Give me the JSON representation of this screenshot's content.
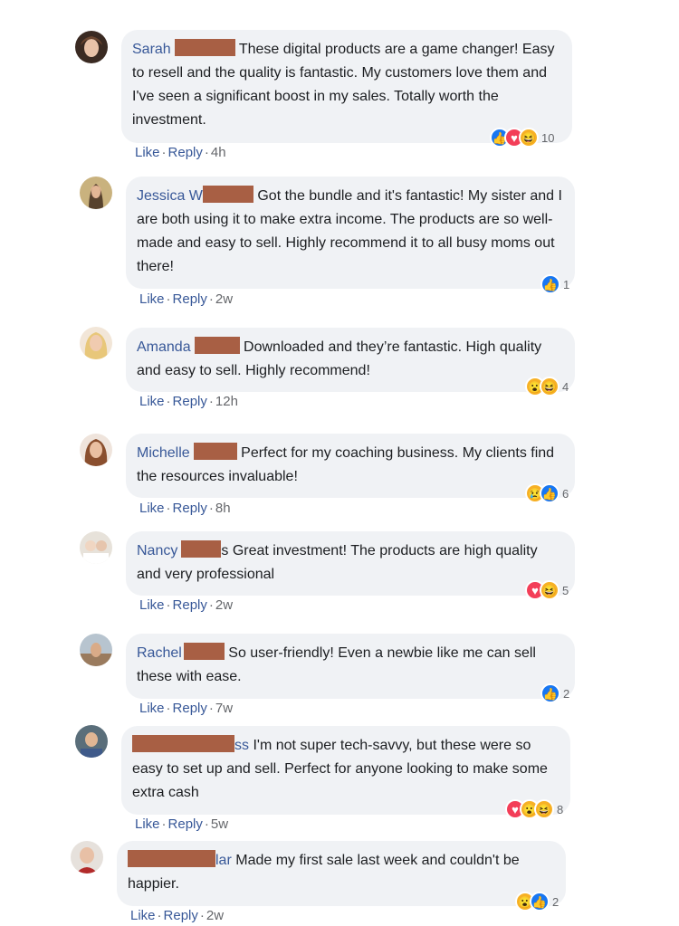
{
  "labels": {
    "like": "Like",
    "reply": "Reply",
    "sep": "·"
  },
  "colors": {
    "link": "#385898",
    "bubble": "#f0f2f5",
    "redaction": "#a85f44"
  },
  "comments": [
    {
      "name": "Sarah",
      "suffix": "",
      "text": "These digital products are a game changer! Easy to resell and the quality is fantastic. My customers love them and I've seen a significant boost in my sales. Totally worth the investment.",
      "time": "4h",
      "reactions": [
        "like",
        "love",
        "haha"
      ],
      "count": "10"
    },
    {
      "name": "Jessica W",
      "suffix": "",
      "text": "Got the bundle and it's fantastic! My sister and I are both using it to make extra income. The products are so well-made and easy to sell. Highly recommend it to all busy moms out there!",
      "time": "2w",
      "reactions": [
        "like"
      ],
      "count": "1"
    },
    {
      "name": "Amanda",
      "suffix": "",
      "text": "Downloaded and they’re fantastic. High quality and easy to sell. Highly recommend!",
      "time": "12h",
      "reactions": [
        "wow",
        "haha"
      ],
      "count": "4"
    },
    {
      "name": "Michelle",
      "suffix": "",
      "text": "Perfect for my coaching business. My clients find the resources invaluable!",
      "time": "8h",
      "reactions": [
        "sad",
        "like"
      ],
      "count": "6"
    },
    {
      "name": "Nancy",
      "suffix": "s",
      "text": "Great investment! The products are high quality and very professional",
      "time": "2w",
      "reactions": [
        "love",
        "haha"
      ],
      "count": "5"
    },
    {
      "name": "Rachel",
      "suffix": "",
      "text": "So user-friendly! Even a newbie like me can sell these with ease.",
      "time": "7w",
      "reactions": [
        "like"
      ],
      "count": "2"
    },
    {
      "name": "",
      "suffix": "ss",
      "text": "I'm not super tech-savvy, but these were so easy to set up and sell. Perfect for anyone looking to make some extra cash",
      "time": "5w",
      "reactions": [
        "love",
        "wow",
        "haha"
      ],
      "count": "8"
    },
    {
      "name": "",
      "suffix": "lar",
      "text": "Made my first sale last week and couldn't be happier.",
      "time": "2w",
      "reactions": [
        "wow",
        "like"
      ],
      "count": "2"
    }
  ]
}
